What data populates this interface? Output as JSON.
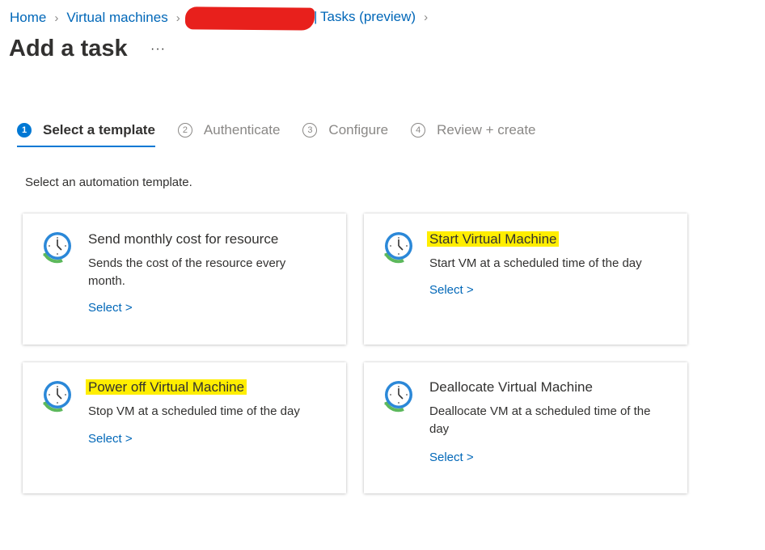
{
  "breadcrumb": {
    "home": "Home",
    "virtual_machines": "Virtual machines",
    "separator_bar": "|",
    "tasks": "Tasks (preview)"
  },
  "page": {
    "title": "Add a task",
    "more": "···"
  },
  "steps": [
    {
      "number": "1",
      "label": "Select a template",
      "active": true
    },
    {
      "number": "2",
      "label": "Authenticate",
      "active": false
    },
    {
      "number": "3",
      "label": "Configure",
      "active": false
    },
    {
      "number": "4",
      "label": "Review + create",
      "active": false
    }
  ],
  "intro": "Select an automation template.",
  "cards": [
    {
      "title": "Send monthly cost for resource",
      "description": "Sends the cost of the resource every month.",
      "select": "Select >",
      "icon": "clock-icon"
    },
    {
      "title": "Start Virtual Machine",
      "description": "Start VM at a scheduled time of the day",
      "select": "Select >",
      "icon": "clock-icon"
    },
    {
      "title": "Power off Virtual Machine",
      "description": "Stop VM at a scheduled time of the day",
      "select": "Select >",
      "icon": "clock-icon"
    },
    {
      "title": "Deallocate Virtual Machine",
      "description": "Deallocate VM at a scheduled time of the day",
      "select": "Select >",
      "icon": "clock-icon"
    }
  ],
  "colors": {
    "accent": "#0078d4",
    "link": "#0067b8",
    "highlight": "#ffee00",
    "redaction": "#e8201c"
  }
}
